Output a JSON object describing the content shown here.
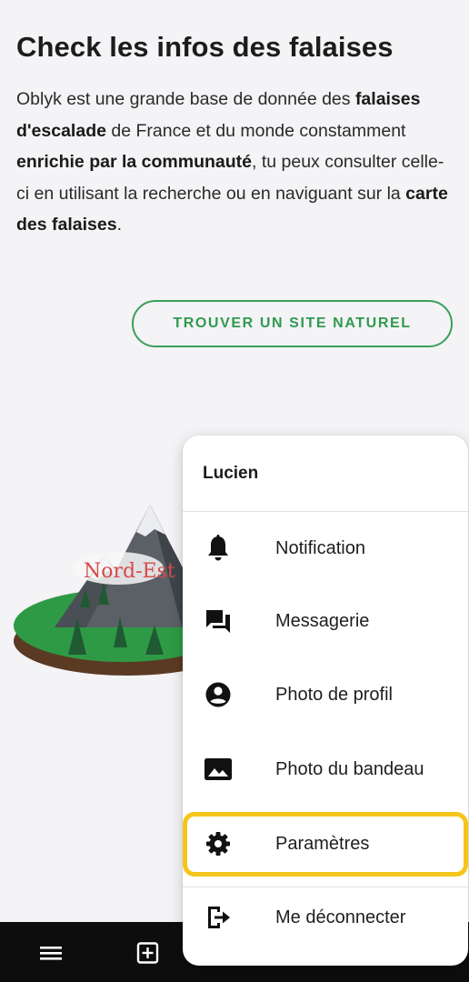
{
  "page": {
    "title": "Check les infos des falaises",
    "description": {
      "p1": "Oblyk est une grande base de donnée des ",
      "b1": "falaises d'escalade",
      "p2": " de France et du monde constamment ",
      "b2": "enrichie par la communauté",
      "p3": ", tu peux consulter celle-ci en utilisant la recherche ou en naviguant sur la ",
      "b3": "carte des falaises",
      "p4": "."
    },
    "cta_label": "TROUVER UN SITE NATUREL",
    "illustration_label": "Nord-Est"
  },
  "menu": {
    "user_name": "Lucien",
    "items": [
      {
        "label": "Notification",
        "icon": "bell-icon"
      },
      {
        "label": "Messagerie",
        "icon": "chat-icon"
      },
      {
        "label": "Photo de profil",
        "icon": "account-circle-icon"
      },
      {
        "label": "Photo du bandeau",
        "icon": "image-icon"
      },
      {
        "label": "Paramètres",
        "icon": "gear-icon"
      },
      {
        "label": "Me déconnecter",
        "icon": "logout-icon"
      }
    ],
    "highlight_color": "#f6c51b"
  },
  "bottom_bar": {
    "icons": [
      "menu-icon",
      "add-box-icon"
    ]
  },
  "colors": {
    "accent": "#2f9a50",
    "background": "#f4f3f6"
  }
}
